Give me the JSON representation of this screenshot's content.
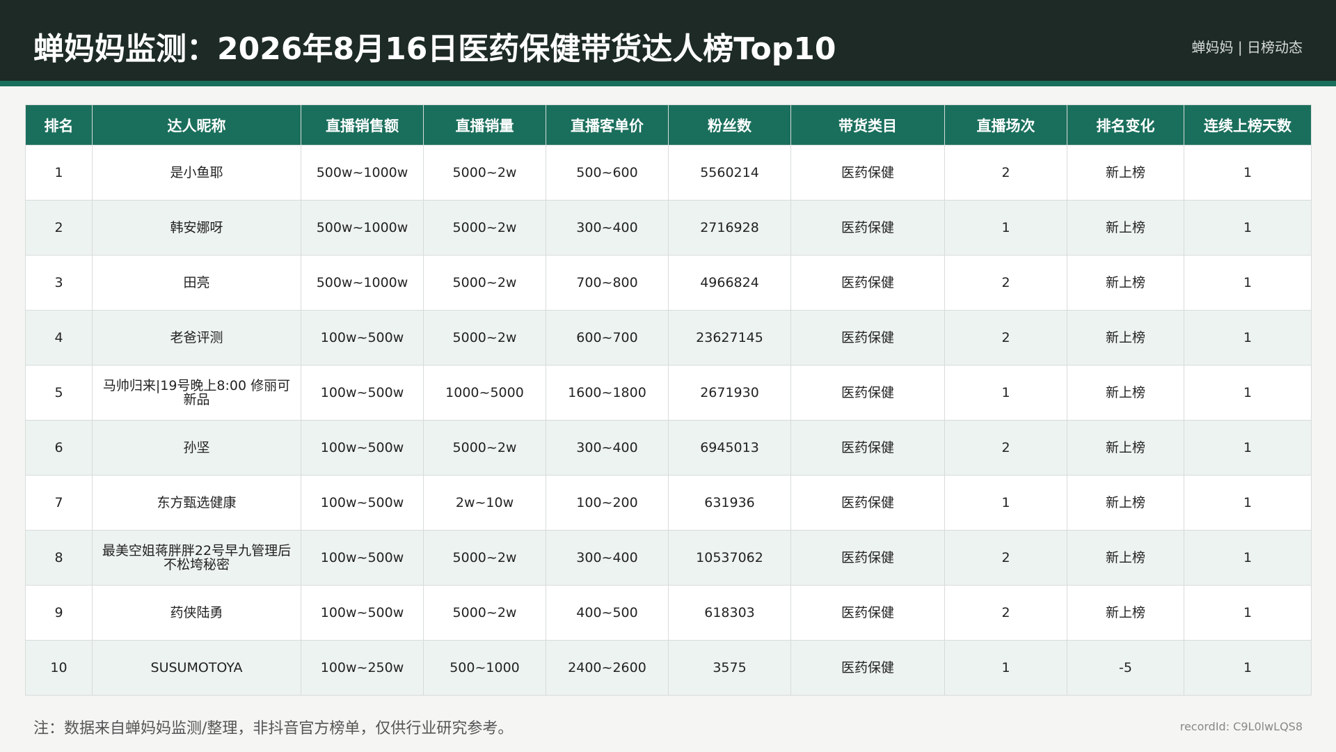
{
  "header": {
    "title": "蝉妈妈监测：2026年8月16日医药保健带货达人榜Top10",
    "brand": "蝉妈妈 | 日榜动态"
  },
  "table": {
    "columns": [
      "排名",
      "达人昵称",
      "直播销售额",
      "直播销量",
      "直播客单价",
      "粉丝数",
      "带货类目",
      "直播场次",
      "排名变化",
      "连续上榜天数"
    ],
    "rows": [
      [
        "1",
        "是小鱼耶",
        "500w~1000w",
        "5000~2w",
        "500~600",
        "5560214",
        "医药保健",
        "2",
        "新上榜",
        "1"
      ],
      [
        "2",
        "韩安娜呀",
        "500w~1000w",
        "5000~2w",
        "300~400",
        "2716928",
        "医药保健",
        "1",
        "新上榜",
        "1"
      ],
      [
        "3",
        "田亮",
        "500w~1000w",
        "5000~2w",
        "700~800",
        "4966824",
        "医药保健",
        "2",
        "新上榜",
        "1"
      ],
      [
        "4",
        "老爸评测",
        "100w~500w",
        "5000~2w",
        "600~700",
        "23627145",
        "医药保健",
        "2",
        "新上榜",
        "1"
      ],
      [
        "5",
        "马帅归来|19号晚上8:00 修丽可新品",
        "100w~500w",
        "1000~5000",
        "1600~1800",
        "2671930",
        "医药保健",
        "1",
        "新上榜",
        "1"
      ],
      [
        "6",
        "孙坚",
        "100w~500w",
        "5000~2w",
        "300~400",
        "6945013",
        "医药保健",
        "2",
        "新上榜",
        "1"
      ],
      [
        "7",
        "东方甄选健康",
        "100w~500w",
        "2w~10w",
        "100~200",
        "631936",
        "医药保健",
        "1",
        "新上榜",
        "1"
      ],
      [
        "8",
        "最美空姐蒋胖胖22号早九管理后不松垮秘密",
        "100w~500w",
        "5000~2w",
        "300~400",
        "10537062",
        "医药保健",
        "2",
        "新上榜",
        "1"
      ],
      [
        "9",
        "药侠陆勇",
        "100w~500w",
        "5000~2w",
        "400~500",
        "618303",
        "医药保健",
        "2",
        "新上榜",
        "1"
      ],
      [
        "10",
        "SUSUMOTOYA",
        "100w~250w",
        "500~1000",
        "2400~2600",
        "3575",
        "医药保健",
        "1",
        "-5",
        "1"
      ]
    ]
  },
  "footer": {
    "note": "注：数据来自蝉妈妈监测/整理，非抖音官方榜单，仅供行业研究参考。",
    "record_id": "recordId: C9L0lwLQS8"
  },
  "colors": {
    "header_bg": "#1d2a26",
    "accent": "#1a6f5c",
    "row_alt": "#edf3f0"
  }
}
